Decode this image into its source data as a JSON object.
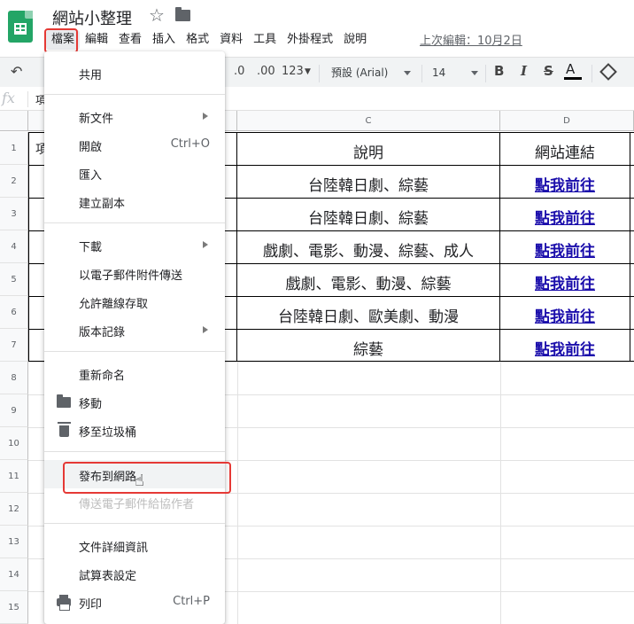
{
  "header": {
    "doc_title": "網站小整理",
    "last_edit": "上次編輯：10月2日"
  },
  "menubar": {
    "items": [
      "檔案",
      "編輯",
      "查看",
      "插入",
      "格式",
      "資料",
      "工具",
      "外掛程式",
      "說明"
    ]
  },
  "toolbar": {
    "decimal_less": ".0",
    "decimal_more": ".00",
    "number_format": "123",
    "font": "預設 (Arial)",
    "font_size": "14",
    "bold": "B",
    "italic": "I",
    "strike": "S",
    "text_color": "A"
  },
  "formula_bar": {
    "fx": "fx",
    "content": "項"
  },
  "columns": [
    "C",
    "D"
  ],
  "rows": [
    "1",
    "2",
    "3",
    "4",
    "5",
    "6",
    "7",
    "8",
    "9",
    "10",
    "11",
    "12",
    "13",
    "14",
    "15"
  ],
  "table": {
    "col_a_first": "項",
    "headers": {
      "description": "說明",
      "link": "網站連結"
    },
    "descriptions": [
      "台陸韓日劇、綜藝",
      "台陸韓日劇、綜藝",
      "戲劇、電影、動漫、綜藝、成人",
      "戲劇、電影、動漫、綜藝",
      "台陸韓日劇、歐美劇、動漫",
      "綜藝"
    ],
    "links": [
      "點我前往",
      "點我前往",
      "點我前往",
      "點我前往",
      "點我前往",
      "點我前往"
    ]
  },
  "file_menu": {
    "share": "共用",
    "new": "新文件",
    "open": "開啟",
    "open_shortcut": "Ctrl+O",
    "import": "匯入",
    "make_copy": "建立副本",
    "download": "下載",
    "email_attachment": "以電子郵件附件傳送",
    "offline": "允許離線存取",
    "version_history": "版本記錄",
    "rename": "重新命名",
    "move": "移動",
    "trash": "移至垃圾桶",
    "publish": "發布到網路",
    "email_collab": "傳送電子郵件給協作者",
    "doc_details": "文件詳細資訊",
    "sheet_settings": "試算表設定",
    "print": "列印",
    "print_shortcut": "Ctrl+P"
  },
  "colors": {
    "highlight": "#e53935",
    "link": "#1a0dab",
    "brand": "#23a566"
  }
}
